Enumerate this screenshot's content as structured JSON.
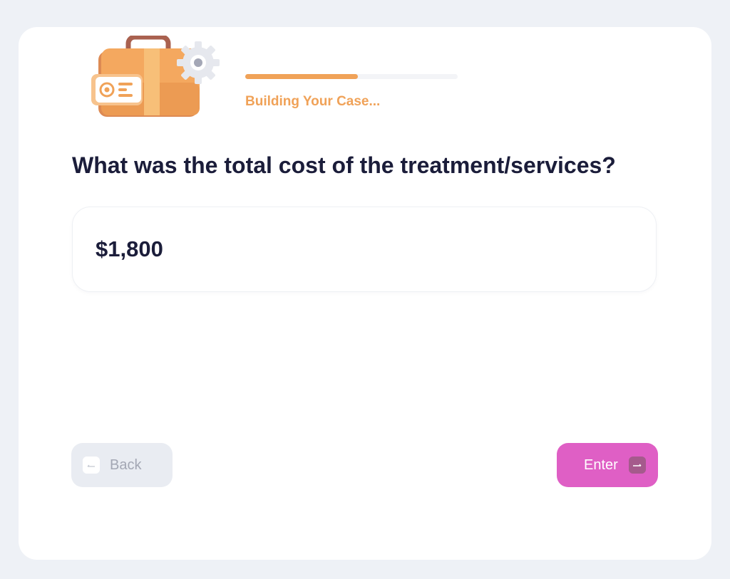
{
  "progress": {
    "fraction": 0.53,
    "label": "Building Your Case..."
  },
  "question": {
    "text": "What was the total cost of the treatment/services?"
  },
  "answer": {
    "value": "$1,800"
  },
  "buttons": {
    "back_label": "Back",
    "enter_label": "Enter"
  },
  "icons": {
    "illustration": "briefcase-gear-icon",
    "back": "arrow-left-icon",
    "enter": "arrow-right-icon"
  },
  "colors": {
    "background": "#eef1f6",
    "card": "#ffffff",
    "accent_orange": "#f0a258",
    "enter_button": "#df5fc5",
    "back_button": "#e9ecf2",
    "heading_text": "#1b1d3a"
  }
}
